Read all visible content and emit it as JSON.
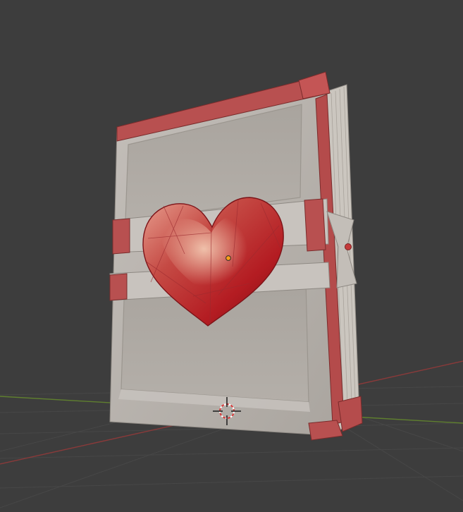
{
  "viewport": {
    "background": "#3d3d3d",
    "grid_color": "#474747",
    "x_axis_color": "#8a3a3a",
    "y_axis_color": "#5f7f2f"
  },
  "scene": {
    "object": "book-with-heart-gem",
    "book_color": "#bdb8b2",
    "strap_color": "#b85050",
    "pages_color": "#d0cbc3",
    "heart_color": "#c0282c",
    "origin_color": "#ff9f1a"
  },
  "icons": {
    "cursor": "3d-cursor-icon",
    "origin": "object-origin-icon"
  }
}
